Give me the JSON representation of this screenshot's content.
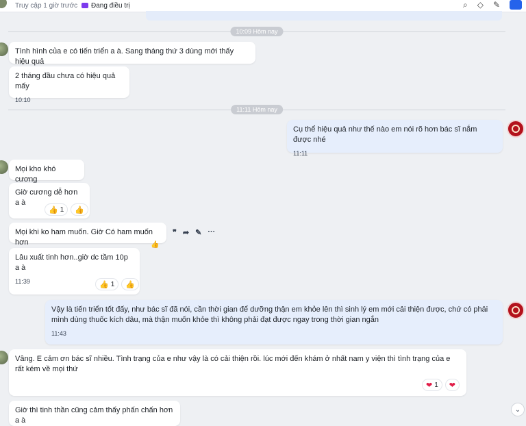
{
  "header": {
    "last_access": "Truy cập 1 giờ trước",
    "status": "Đang điều trị",
    "status_color": "#7c3aed"
  },
  "dividers": [
    "10:09 Hôm nay",
    "11:11 Hôm nay"
  ],
  "messages": {
    "m1": {
      "text": "Tình hình của e có tiến triển a à. Sang tháng thứ 3 dùng mới thấy hiệu quả"
    },
    "m2": {
      "text": "2 tháng đầu chưa có hiệu quả mấy",
      "time": "10:10"
    },
    "m3": {
      "text": "Cụ thể hiệu quả như thế nào em nói rõ hơn bác sĩ nắm được nhé",
      "time": "11:11"
    },
    "m4": {
      "text": "Mọi kho khó cương"
    },
    "m5": {
      "text": "Giờ cương dễ hơn a à",
      "reaction_count": "1"
    },
    "m6": {
      "text": "Mọi khi ko ham muốn. Giờ Có ham muốn hơn"
    },
    "m7": {
      "text": "Lâu xuất tinh hơn..giờ  dc tầm 10p a à",
      "time": "11:39",
      "reaction_count": "1"
    },
    "m8": {
      "text": "Vậy là tiến triển tốt đấy, như bác sĩ đã nói, cần thời gian để dưỡng thận em khỏe lên thì sinh lý em mới cải thiện được, chứ có phải mình dùng thuốc kích dâu, mà thận muốn khỏe thì không phải đạt được ngay trong thời gian ngắn",
      "time": "11:43"
    },
    "m9": {
      "text": "Vâng. E cảm ơn bác sĩ nhiều. Tình trạng của e như vậy là có cải thiện  rồi.  lúc mới đến khám ở nhất nam y viện thì tình trạng của e rất kém về mọi thứ",
      "reaction_count": "1"
    },
    "m10": {
      "text": "Giờ thì tinh thần cũng cảm thấy phấn chấn hơn a à"
    }
  },
  "colors": {
    "outgoing_bubble": "#e6eefc",
    "incoming_bubble": "#ffffff",
    "accent": "#2563eb"
  }
}
